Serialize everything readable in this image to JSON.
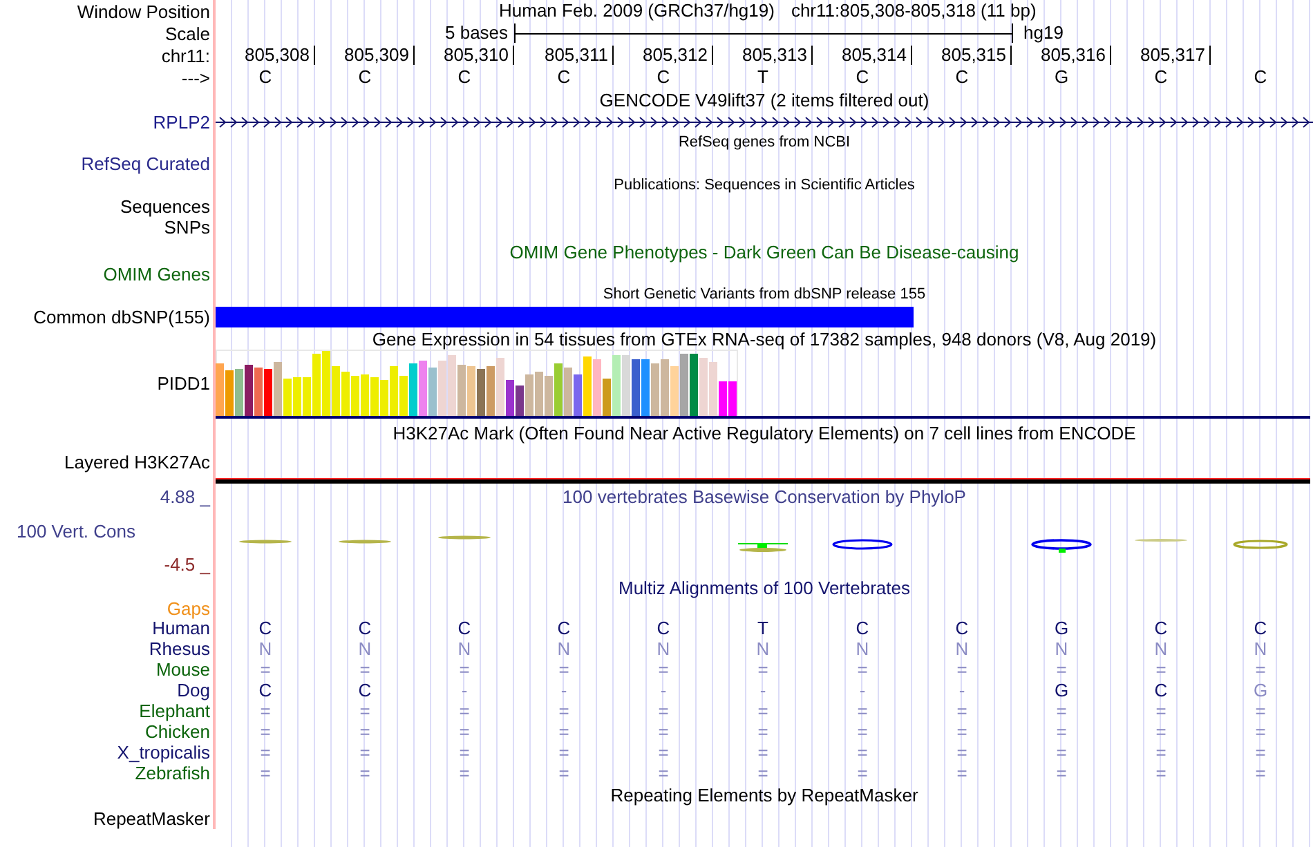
{
  "header": {
    "window_position_label": "Window Position",
    "assembly_title": "Human Feb. 2009 (GRCh37/hg19)",
    "position": "chr11:805,308-805,318 (11 bp)",
    "scale_label": "Scale",
    "scale_text": "5 bases",
    "scale_assembly": "hg19",
    "chrom_label": "chr11:",
    "strand_label": "--->"
  },
  "positions": [
    "805,308",
    "805,309",
    "805,310",
    "805,311",
    "805,312",
    "805,313",
    "805,314",
    "805,315",
    "805,316",
    "805,317"
  ],
  "bases": [
    "C",
    "C",
    "C",
    "C",
    "C",
    "T",
    "C",
    "C",
    "G",
    "C",
    "C"
  ],
  "gencode": {
    "title": "GENCODE V49lift37 (2 items filtered out)",
    "label": "RPLP2"
  },
  "refseq": {
    "title": "RefSeq genes from NCBI",
    "label": "RefSeq Curated"
  },
  "publications": {
    "title": "Publications: Sequences in Scientific Articles",
    "labels": [
      "Sequences",
      "SNPs"
    ]
  },
  "omim": {
    "title": "OMIM Gene Phenotypes - Dark Green Can Be Disease-causing",
    "label": "OMIM Genes"
  },
  "dbsnp": {
    "title": "Short Genetic Variants from dbSNP release 155",
    "label": "Common dbSNP(155)"
  },
  "gtex": {
    "title": "Gene Expression in 54 tissues from GTEx RNA-seq of 17382 samples, 948 donors (V8, Aug 2019)",
    "label": "PIDD1"
  },
  "h3k27ac": {
    "title": "H3K27Ac Mark (Often Found Near Active Regulatory Elements) on 7 cell lines from ENCODE",
    "label": "Layered H3K27Ac"
  },
  "conservation": {
    "title": "100 vertebrates Basewise Conservation by PhyloP",
    "label": "100 Vert. Cons",
    "max_label": "4.88 _",
    "min_label": "-4.5 _"
  },
  "multiz": {
    "title": "Multiz Alignments of 100 Vertebrates",
    "gaps_label": "Gaps",
    "species": [
      {
        "name": "Human",
        "color": "#14146e",
        "bases": [
          {
            "text": "C",
            "dim": false
          },
          {
            "text": "C",
            "dim": false
          },
          {
            "text": "C",
            "dim": false
          },
          {
            "text": "C",
            "dim": false
          },
          {
            "text": "C",
            "dim": false
          },
          {
            "text": "T",
            "dim": false
          },
          {
            "text": "C",
            "dim": false
          },
          {
            "text": "C",
            "dim": false
          },
          {
            "text": "G",
            "dim": false
          },
          {
            "text": "C",
            "dim": false
          },
          {
            "text": "C",
            "dim": false
          }
        ]
      },
      {
        "name": "Rhesus",
        "color": "#14146e",
        "bases": [
          {
            "text": "N",
            "dim": true
          },
          {
            "text": "N",
            "dim": true
          },
          {
            "text": "N",
            "dim": true
          },
          {
            "text": "N",
            "dim": true
          },
          {
            "text": "N",
            "dim": true
          },
          {
            "text": "N",
            "dim": true
          },
          {
            "text": "N",
            "dim": true
          },
          {
            "text": "N",
            "dim": true
          },
          {
            "text": "N",
            "dim": true
          },
          {
            "text": "N",
            "dim": true
          },
          {
            "text": "N",
            "dim": true
          }
        ]
      },
      {
        "name": "Mouse",
        "color": "#0b640b",
        "bases": [
          {
            "text": "=",
            "dim": true
          },
          {
            "text": "=",
            "dim": true
          },
          {
            "text": "=",
            "dim": true
          },
          {
            "text": "=",
            "dim": true
          },
          {
            "text": "=",
            "dim": true
          },
          {
            "text": "=",
            "dim": true
          },
          {
            "text": "=",
            "dim": true
          },
          {
            "text": "=",
            "dim": true
          },
          {
            "text": "=",
            "dim": true
          },
          {
            "text": "=",
            "dim": true
          },
          {
            "text": "=",
            "dim": true
          }
        ]
      },
      {
        "name": "Dog",
        "color": "#14146e",
        "bases": [
          {
            "text": "C",
            "dim": false
          },
          {
            "text": "C",
            "dim": false
          },
          {
            "text": "-",
            "dim": true
          },
          {
            "text": "-",
            "dim": true
          },
          {
            "text": "-",
            "dim": true
          },
          {
            "text": "-",
            "dim": true
          },
          {
            "text": "-",
            "dim": true
          },
          {
            "text": "-",
            "dim": true
          },
          {
            "text": "G",
            "dim": false
          },
          {
            "text": "C",
            "dim": false
          },
          {
            "text": "G",
            "dim": true
          }
        ]
      },
      {
        "name": "Elephant",
        "color": "#0b640b",
        "bases": [
          {
            "text": "=",
            "dim": true
          },
          {
            "text": "=",
            "dim": true
          },
          {
            "text": "=",
            "dim": true
          },
          {
            "text": "=",
            "dim": true
          },
          {
            "text": "=",
            "dim": true
          },
          {
            "text": "=",
            "dim": true
          },
          {
            "text": "=",
            "dim": true
          },
          {
            "text": "=",
            "dim": true
          },
          {
            "text": "=",
            "dim": true
          },
          {
            "text": "=",
            "dim": true
          },
          {
            "text": "=",
            "dim": true
          }
        ]
      },
      {
        "name": "Chicken",
        "color": "#0b640b",
        "bases": [
          {
            "text": "=",
            "dim": true
          },
          {
            "text": "=",
            "dim": true
          },
          {
            "text": "=",
            "dim": true
          },
          {
            "text": "=",
            "dim": true
          },
          {
            "text": "=",
            "dim": true
          },
          {
            "text": "=",
            "dim": true
          },
          {
            "text": "=",
            "dim": true
          },
          {
            "text": "=",
            "dim": true
          },
          {
            "text": "=",
            "dim": true
          },
          {
            "text": "=",
            "dim": true
          },
          {
            "text": "=",
            "dim": true
          }
        ]
      },
      {
        "name": "X_tropicalis",
        "color": "#14146e",
        "bases": [
          {
            "text": "=",
            "dim": true
          },
          {
            "text": "=",
            "dim": true
          },
          {
            "text": "=",
            "dim": true
          },
          {
            "text": "=",
            "dim": true
          },
          {
            "text": "=",
            "dim": true
          },
          {
            "text": "=",
            "dim": true
          },
          {
            "text": "=",
            "dim": true
          },
          {
            "text": "=",
            "dim": true
          },
          {
            "text": "=",
            "dim": true
          },
          {
            "text": "=",
            "dim": true
          },
          {
            "text": "=",
            "dim": true
          }
        ]
      },
      {
        "name": "Zebrafish",
        "color": "#0b640b",
        "bases": [
          {
            "text": "=",
            "dim": true
          },
          {
            "text": "=",
            "dim": true
          },
          {
            "text": "=",
            "dim": true
          },
          {
            "text": "=",
            "dim": true
          },
          {
            "text": "=",
            "dim": true
          },
          {
            "text": "=",
            "dim": true
          },
          {
            "text": "=",
            "dim": true
          },
          {
            "text": "=",
            "dim": true
          },
          {
            "text": "=",
            "dim": true
          },
          {
            "text": "=",
            "dim": true
          },
          {
            "text": "=",
            "dim": true
          }
        ]
      }
    ]
  },
  "repeatmasker": {
    "title": "Repeating Elements by RepeatMasker",
    "label": "RepeatMasker"
  }
}
